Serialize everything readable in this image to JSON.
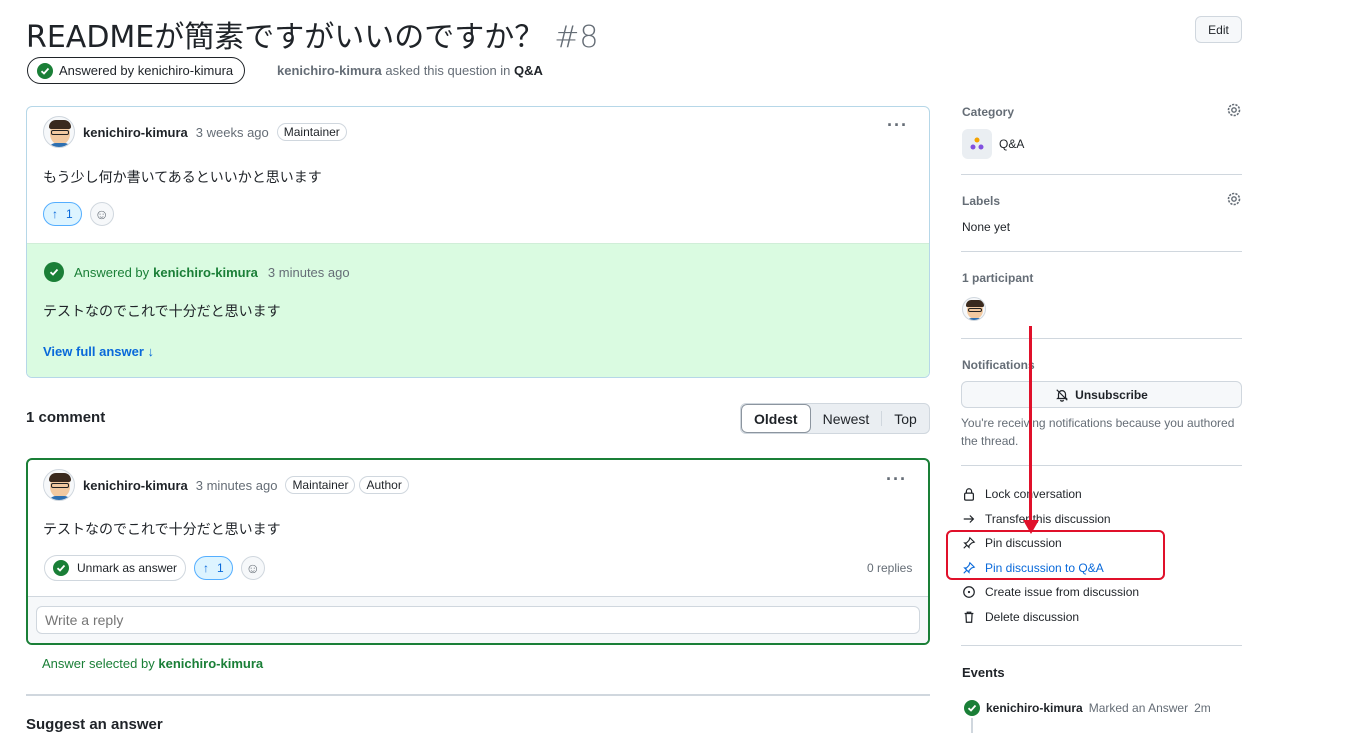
{
  "discussion": {
    "title": "READMEが簡素ですがいいのですか？",
    "number": "#8",
    "edit_label": "Edit",
    "answered_pill": "Answered by kenichiro-kimura",
    "author": "kenichiro-kimura",
    "asked_text": "asked this question in",
    "category": "Q&A"
  },
  "question": {
    "author": "kenichiro-kimura",
    "time": "3 weeks ago",
    "badge": "Maintainer",
    "body": "もう少し何か書いてあるといいかと思います",
    "upvotes": "1",
    "answer": {
      "answered_by_prefix": "Answered by",
      "answered_by_user": "kenichiro-kimura",
      "time": "3 minutes ago",
      "body": "テストなのでこれで十分だと思います",
      "view_full": "View full answer"
    }
  },
  "comments_header": {
    "count_label": "1 comment",
    "sort_options": [
      "Oldest",
      "Newest",
      "Top"
    ],
    "active_sort": "Oldest"
  },
  "comment": {
    "author": "kenichiro-kimura",
    "time": "3 minutes ago",
    "badges": [
      "Maintainer",
      "Author"
    ],
    "body": "テストなのでこれで十分だと思います",
    "unmark_label": "Unmark as answer",
    "upvotes": "1",
    "replies": "0 replies",
    "reply_placeholder": "Write a reply",
    "answer_selected_prefix": "Answer selected by",
    "answer_selected_user": "kenichiro-kimura"
  },
  "suggest_answer": "Suggest an answer",
  "sidebar": {
    "category_heading": "Category",
    "category_value": "Q&A",
    "labels_heading": "Labels",
    "labels_value": "None yet",
    "participants_heading": "1 participant",
    "notifications_heading": "Notifications",
    "unsubscribe_label": "Unsubscribe",
    "notification_reason": "You're receiving notifications because you authored the thread.",
    "actions": [
      {
        "label": "Lock conversation",
        "icon": "lock-icon"
      },
      {
        "label": "Transfer this discussion",
        "icon": "arrow-right-icon"
      },
      {
        "label": "Pin discussion",
        "icon": "pin-icon"
      },
      {
        "label": "Pin discussion to Q&A",
        "icon": "pin-icon"
      },
      {
        "label": "Create issue from discussion",
        "icon": "issue-opened-icon"
      },
      {
        "label": "Delete discussion",
        "icon": "trash-icon"
      }
    ],
    "events_heading": "Events",
    "event": {
      "user": "kenichiro-kimura",
      "action": "Marked an Answer",
      "time": "2m"
    }
  },
  "colors": {
    "accent_green": "#1a7f37",
    "link_blue": "#0969da",
    "annotation_red": "#e0102a",
    "answer_bg": "#dafbe1"
  }
}
